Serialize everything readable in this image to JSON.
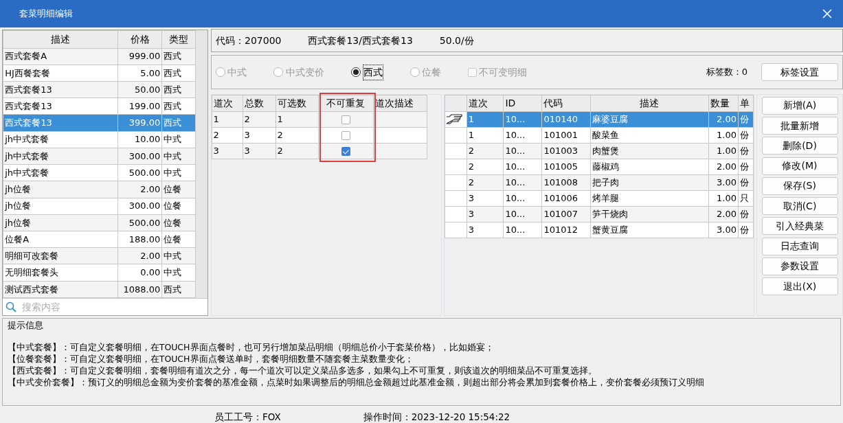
{
  "window": {
    "title": "套菜明细编辑"
  },
  "package_list": {
    "columns": [
      "描述",
      "价格",
      "类型"
    ],
    "rows": [
      {
        "cells": [
          "西式套餐A",
          "999.00",
          "西式"
        ],
        "selected": false
      },
      {
        "cells": [
          "HJ西餐套餐",
          "5.00",
          "西式"
        ],
        "selected": false
      },
      {
        "cells": [
          "西式套餐13",
          "50.00",
          "西式"
        ],
        "selected": false
      },
      {
        "cells": [
          "西式套餐13",
          "199.00",
          "西式"
        ],
        "selected": false
      },
      {
        "cells": [
          "西式套餐13",
          "399.00",
          "西式"
        ],
        "selected": true
      },
      {
        "cells": [
          "jh中式套餐",
          "10.00",
          "中式"
        ],
        "selected": false
      },
      {
        "cells": [
          "jh中式套餐",
          "300.00",
          "中式"
        ],
        "selected": false
      },
      {
        "cells": [
          "jh中式套餐",
          "500.00",
          "中式"
        ],
        "selected": false
      },
      {
        "cells": [
          "jh位餐",
          "2.00",
          "位餐"
        ],
        "selected": false
      },
      {
        "cells": [
          "jh位餐",
          "300.00",
          "位餐"
        ],
        "selected": false
      },
      {
        "cells": [
          "jh位餐",
          "500.00",
          "位餐"
        ],
        "selected": false
      },
      {
        "cells": [
          "位餐A",
          "188.00",
          "位餐"
        ],
        "selected": false
      },
      {
        "cells": [
          "明细可改套餐",
          "2.00",
          "中式"
        ],
        "selected": false
      },
      {
        "cells": [
          "无明细套餐头",
          "0.00",
          "中式"
        ],
        "selected": false
      },
      {
        "cells": [
          "测试西式套餐",
          "1088.00",
          "西式"
        ],
        "selected": false
      }
    ],
    "search": {
      "placeholder": "搜索内容"
    }
  },
  "info": {
    "code_label": "代码：",
    "code": "207000",
    "name": "西式套餐13/西式套餐13",
    "price": "50.0/份"
  },
  "types": [
    {
      "label": "中式",
      "selected": false
    },
    {
      "label": "中式变价",
      "selected": false
    },
    {
      "label": "西式",
      "selected": true
    },
    {
      "label": "位餐",
      "selected": false
    }
  ],
  "fixed_detail": {
    "label": "不可变明细",
    "checked": false
  },
  "tag_count": "标签数：0",
  "tag_button": "标签设置",
  "courses": {
    "columns": [
      "道次",
      "总数",
      "可选数",
      "不可重复",
      "道次描述"
    ],
    "rows": [
      {
        "course": "1",
        "total": "2",
        "optional": "1",
        "no_repeat": false
      },
      {
        "course": "2",
        "total": "3",
        "optional": "2",
        "no_repeat": false
      },
      {
        "course": "3",
        "total": "3",
        "optional": "2",
        "no_repeat": true
      }
    ]
  },
  "items": {
    "columns": [
      "道次",
      "ID",
      "代码",
      "描述",
      "数量",
      "单"
    ],
    "rows": [
      {
        "cells": [
          "1",
          "10...",
          "010140",
          "麻婆豆腐",
          "2.00",
          "份"
        ],
        "selected": true
      },
      {
        "cells": [
          "1",
          "10...",
          "101001",
          "酸菜鱼",
          "1.00",
          "份"
        ],
        "selected": false
      },
      {
        "cells": [
          "2",
          "10...",
          "101003",
          "肉蟹煲",
          "1.00",
          "份"
        ],
        "selected": false
      },
      {
        "cells": [
          "2",
          "10...",
          "101005",
          "藤椒鸡",
          "2.00",
          "份"
        ],
        "selected": false
      },
      {
        "cells": [
          "2",
          "10...",
          "101008",
          "把子肉",
          "3.00",
          "份"
        ],
        "selected": false
      },
      {
        "cells": [
          "3",
          "10...",
          "101006",
          "烤羊腿",
          "1.00",
          "只"
        ],
        "selected": false
      },
      {
        "cells": [
          "3",
          "10...",
          "101007",
          "笋干烧肉",
          "2.00",
          "份"
        ],
        "selected": false
      },
      {
        "cells": [
          "3",
          "10...",
          "101012",
          "蟹黄豆腐",
          "3.00",
          "份"
        ],
        "selected": false
      }
    ]
  },
  "buttons": [
    "新增(A)",
    "批量新增",
    "删除(D)",
    "修改(M)",
    "保存(S)",
    "取消(C)",
    "引入经典菜",
    "日志查询",
    "参数设置",
    "退出(X)"
  ],
  "hints": {
    "title": "提示信息",
    "lines": [
      "【中式套餐】：可自定义套餐明细，在TOUCH界面点餐时，也可另行增加菜品明细（明细总价小于套菜价格），比如婚宴；",
      "【位餐套餐】：可自定义套餐明细，在TOUCH界面点餐送单时，套餐明细数量不随套餐主菜数量变化；",
      "【西式套餐】：可自定义套餐明细，套餐明细有道次之分，每一个道次可以定义菜品多选多，如果勾上不可重复，则该道次的明细菜品不可重复选择。",
      "【中式变价套餐】：预订义的明细总金额为变价套餐的基准金额，点菜时如果调整后的明细总金额超过此基准金额，则超出部分将会累加到套餐价格上，变价套餐必须预订义明细"
    ]
  },
  "status_bar": {
    "employee": "员工工号：FOX",
    "time": "操作时间：2023-12-20 15:54:22"
  }
}
